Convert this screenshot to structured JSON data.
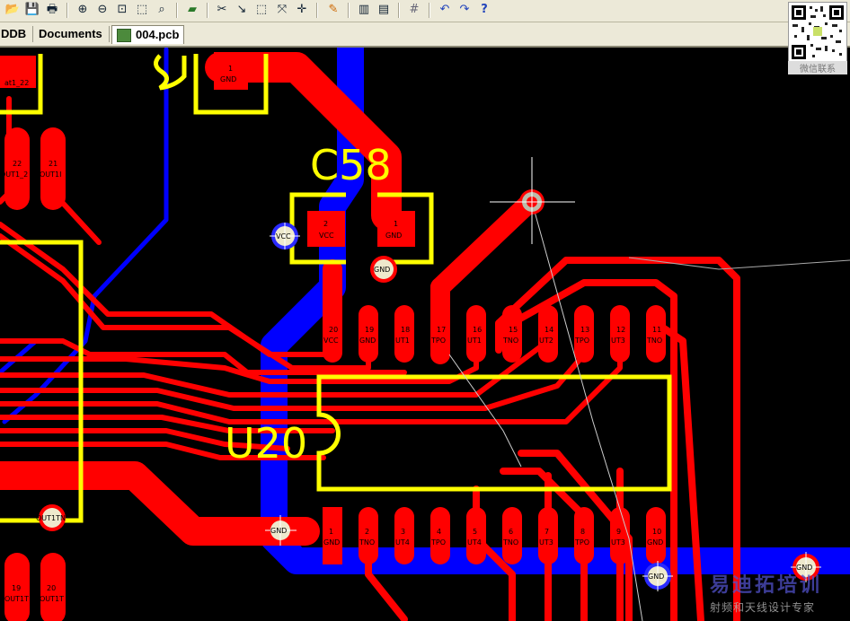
{
  "toolbar": {
    "icons": [
      "open-icon",
      "save-icon",
      "print-icon",
      "zoom-in-icon",
      "zoom-out-icon",
      "zoom-fit-icon",
      "zoom-area-icon",
      "zoom-select-icon",
      "layer-icon",
      "route-icon",
      "track-icon",
      "select-icon",
      "move-icon",
      "cross-icon",
      "highlight-icon",
      "3d-icon",
      "component-icon",
      "grid-icon",
      "undo-icon",
      "redo-icon",
      "help-icon"
    ]
  },
  "tabs": {
    "ddb": "DDB",
    "documents": "Documents",
    "active": "004.pcb"
  },
  "qr": {
    "caption": "微信联系"
  },
  "board": {
    "designators": {
      "c58": "C58",
      "u20": "U20"
    },
    "c58_pads": [
      {
        "num": "2",
        "net": "VCC"
      },
      {
        "num": "1",
        "net": "GND"
      }
    ],
    "top_pad": {
      "num": "1",
      "net": "GND"
    },
    "left_pads": [
      {
        "num": "22",
        "net": "OUT1_2"
      },
      {
        "num": "21",
        "net": "OUT1I"
      },
      {
        "num": "19",
        "net": "OUT1T"
      },
      {
        "num": "20",
        "net": "OUT1T"
      }
    ],
    "left_top_label": "at1_22",
    "u20_top_pads": [
      {
        "num": "20",
        "net": "VCC"
      },
      {
        "num": "19",
        "net": "GND"
      },
      {
        "num": "18",
        "net": "UT1"
      },
      {
        "num": "17",
        "net": "TPO"
      },
      {
        "num": "16",
        "net": "UT1"
      },
      {
        "num": "15",
        "net": "TNO"
      },
      {
        "num": "14",
        "net": "UT2"
      },
      {
        "num": "13",
        "net": "TPO"
      },
      {
        "num": "12",
        "net": "UT3"
      },
      {
        "num": "11",
        "net": "TNO"
      }
    ],
    "u20_bottom_pads": [
      {
        "num": "1",
        "net": "GND"
      },
      {
        "num": "2",
        "net": "TNO"
      },
      {
        "num": "3",
        "net": "UT4"
      },
      {
        "num": "4",
        "net": "TPO"
      },
      {
        "num": "5",
        "net": "UT4"
      },
      {
        "num": "6",
        "net": "TNO"
      },
      {
        "num": "7",
        "net": "UT3"
      },
      {
        "num": "8",
        "net": "TPO"
      },
      {
        "num": "9",
        "net": "UT3"
      },
      {
        "num": "10",
        "net": "GND"
      }
    ],
    "vias": [
      {
        "net": "VCC"
      },
      {
        "net": "GND"
      },
      {
        "net": "OUT1TN"
      },
      {
        "net": "GND"
      },
      {
        "net": "GND"
      },
      {
        "net": "GND"
      },
      {
        "net": ""
      }
    ]
  },
  "watermark": {
    "title": "易迪拓培训",
    "subtitle": "射频和天线设计专家"
  },
  "colors": {
    "top_layer": "#ff0000",
    "bottom_layer": "#0000ff",
    "overlay": "#ffff00",
    "background": "#000000"
  }
}
